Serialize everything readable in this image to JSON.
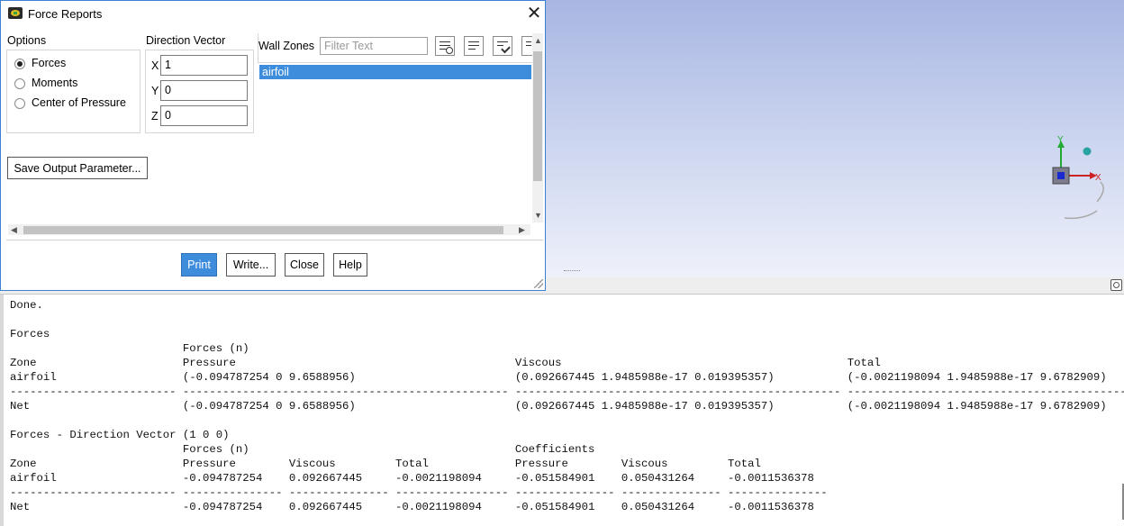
{
  "dialog": {
    "title": "Force Reports",
    "close_glyph": "✕",
    "options": {
      "label": "Options",
      "items": [
        {
          "label": "Forces",
          "selected": true
        },
        {
          "label": "Moments",
          "selected": false
        },
        {
          "label": "Center of Pressure",
          "selected": false
        }
      ]
    },
    "direction_vector": {
      "label": "Direction Vector",
      "x_label": "X",
      "x_value": "1",
      "y_label": "Y",
      "y_value": "0",
      "z_label": "Z",
      "z_value": "0"
    },
    "wall_zones": {
      "label": "Wall Zones",
      "filter_placeholder": "Filter Text",
      "items": [
        "airfoil"
      ]
    },
    "save_output_label": "Save Output Parameter...",
    "buttons": {
      "print": "Print",
      "write": "Write...",
      "close": "Close",
      "help": "Help"
    }
  },
  "triad": {
    "x_label": "X",
    "y_label": "Y"
  },
  "console": {
    "lines": [
      "Done.",
      "",
      "Forces",
      "                          Forces (n)",
      "Zone                      Pressure                                          Viscous                                           Total",
      "airfoil                   (-0.094787254 0 9.6588956)                        (0.092667445 1.9485988e-17 0.019395357)           (-0.0021198094 1.9485988e-17 9.6782909)",
      "------------------------- ------------------------------------------------- ------------------------------------------------- -------------------------------------------------",
      "Net                       (-0.094787254 0 9.6588956)                        (0.092667445 1.9485988e-17 0.019395357)           (-0.0021198094 1.9485988e-17 9.6782909)",
      "",
      "Forces - Direction Vector (1 0 0)",
      "                          Forces (n)                                        Coefficients",
      "Zone                      Pressure        Viscous         Total             Pressure        Viscous         Total",
      "airfoil                   -0.094787254    0.092667445     -0.0021198094     -0.051584901    0.050431264     -0.0011536378",
      "------------------------- --------------- --------------- ----------------- --------------- --------------- ---------------",
      "Net                       -0.094787254    0.092667445     -0.0021198094     -0.051584901    0.050431264     -0.0011536378"
    ]
  }
}
